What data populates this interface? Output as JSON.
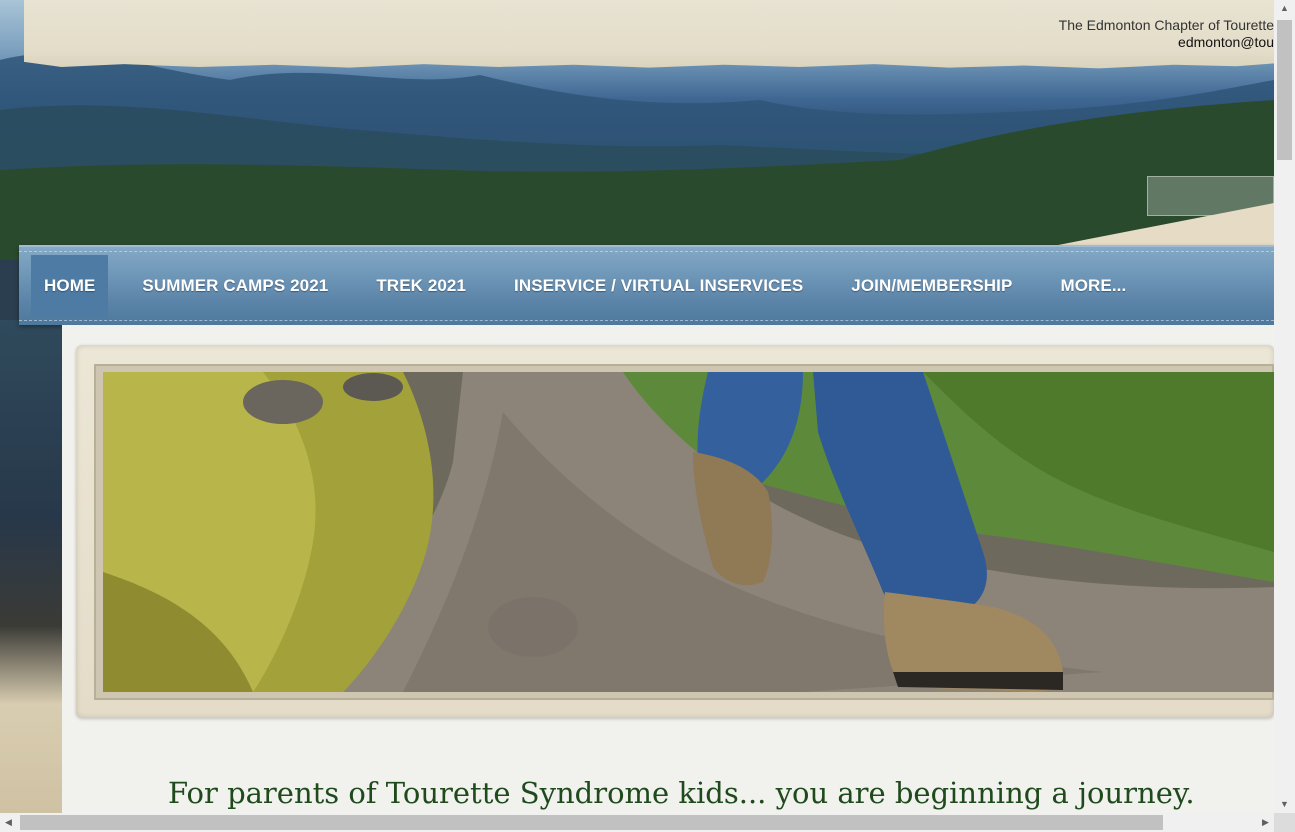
{
  "header": {
    "org_line": "The Edmonton  Chapter of Tourette",
    "email_line": "edmonton@tou"
  },
  "nav": {
    "items": [
      {
        "label": "HOME"
      },
      {
        "label": "SUMMER CAMPS 2021"
      },
      {
        "label": "TREK 2021"
      },
      {
        "label": "INSERVICE / VIRTUAL INSERVICES"
      },
      {
        "label": "JOIN/MEMBERSHIP"
      },
      {
        "label": "MORE..."
      }
    ]
  },
  "main": {
    "tagline": "For parents of  Tourette Syndrome kids... you are beginning a journey."
  },
  "colors": {
    "nav_bg": "#6f97b8",
    "nav_active": "#4e7ba3",
    "tagline": "#1f4a1c"
  },
  "scrollbars": {
    "up_arrow": "▲",
    "down_arrow": "▼",
    "left_arrow": "◀",
    "right_arrow": "▶"
  }
}
